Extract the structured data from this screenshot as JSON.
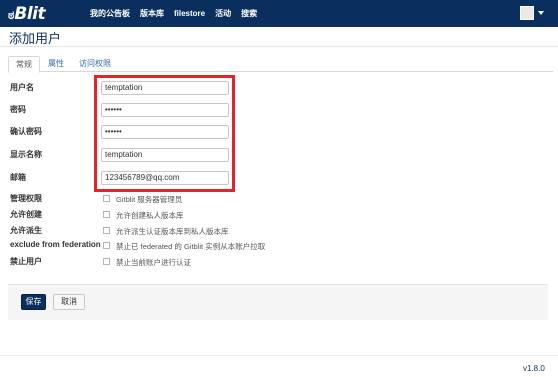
{
  "brand": {
    "mark": "ಠ",
    "word": "Blit"
  },
  "nav": {
    "items": [
      "我的公告板",
      "版本库",
      "filestore",
      "活动",
      "搜索"
    ]
  },
  "page": {
    "title": "添加用户"
  },
  "tabs": [
    "常规",
    "属性",
    "访问权限"
  ],
  "fields": [
    {
      "label": "用户名",
      "value": "temptation"
    },
    {
      "label": "密码",
      "value": "••••••"
    },
    {
      "label": "确认密码",
      "value": "••••••"
    },
    {
      "label": "显示名称",
      "value": "temptation"
    },
    {
      "label": "邮箱",
      "value": "123456789@qq.com"
    }
  ],
  "checkboxes": [
    {
      "label": "管理权限",
      "text": "Gitblit 服务器管理员"
    },
    {
      "label": "允许创建",
      "text": "允许创建私人版本库"
    },
    {
      "label": "允许派生",
      "text": "允许派生认证版本库到私人版本库"
    },
    {
      "label": "exclude from federation",
      "text": "禁止已 federated 的 Gitblit 实例从本账户拉取"
    },
    {
      "label": "禁止用户",
      "text": "禁止当前账户进行认证"
    }
  ],
  "actions": {
    "save": "保存",
    "cancel": "取消"
  },
  "footer": {
    "version": "v1.8.0"
  },
  "colors": {
    "navbar": "#0a2f5e",
    "highlight": "#e0252b"
  }
}
